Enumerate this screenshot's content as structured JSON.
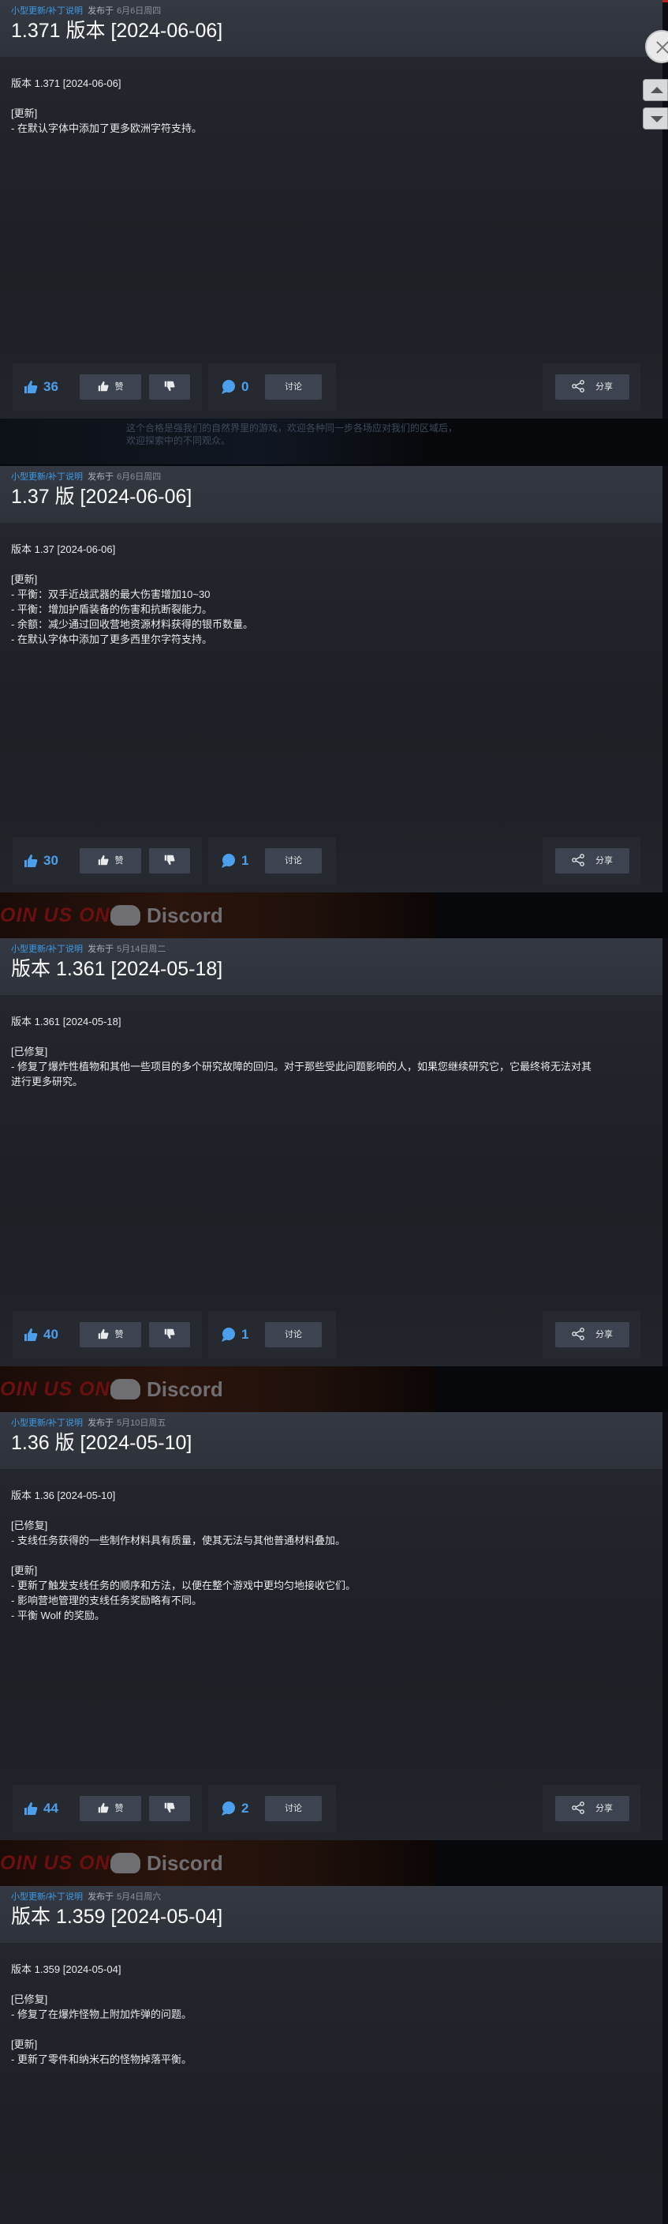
{
  "posts": [
    {
      "tag": "小型更新/补丁说明",
      "published_prefix": "发布于",
      "date": "6月6日周四",
      "title": "1.371 版本 [2024-06-06]",
      "lines": [
        "版本 1.371 [2024-06-06]",
        "",
        "[更新]",
        "- 在默认字体中添加了更多欧洲字符支持。"
      ],
      "likes": "36",
      "comments": "0"
    },
    {
      "tag": "小型更新/补丁说明",
      "published_prefix": "发布于",
      "date": "6月6日周四",
      "title": "1.37 版 [2024-06-06]",
      "lines": [
        "版本 1.37 [2024-06-06]",
        "",
        "[更新]",
        "- 平衡：双手近战武器的最大伤害增加10~30",
        "- 平衡：增加护盾装备的伤害和抗断裂能力。",
        "- 余额：减少通过回收营地资源材料获得的银币数量。",
        "- 在默认字体中添加了更多西里尔字符支持。"
      ],
      "likes": "30",
      "comments": "1"
    },
    {
      "tag": "小型更新/补丁说明",
      "published_prefix": "发布于",
      "date": "5月14日周二",
      "title": "版本 1.361 [2024-05-18]",
      "lines": [
        "版本 1.361 [2024-05-18]",
        "",
        "[已修复]",
        "- 修复了爆炸性植物和其他一些项目的多个研究故障的回归。对于那些受此问题影响的人，如果您继续研究它，它最终将无法对其",
        "进行更多研究。"
      ],
      "likes": "40",
      "comments": "1"
    },
    {
      "tag": "小型更新/补丁说明",
      "published_prefix": "发布于",
      "date": "5月10日周五",
      "title": "1.36 版 [2024-05-10]",
      "lines": [
        "版本 1.36 [2024-05-10]",
        "",
        "[已修复]",
        "- 支线任务获得的一些制作材料具有质量，使其无法与其他普通材料叠加。",
        "",
        "[更新]",
        "- 更新了触发支线任务的顺序和方法，以便在整个游戏中更均匀地接收它们。",
        "- 影响营地管理的支线任务奖励略有不同。",
        "- 平衡 Wolf 的奖励。"
      ],
      "likes": "44",
      "comments": "2"
    },
    {
      "tag": "小型更新/补丁说明",
      "published_prefix": "发布于",
      "date": "5月4日周六",
      "title": "版本 1.359 [2024-05-04]",
      "lines": [
        "版本 1.359 [2024-05-04]",
        "",
        "[已修复]",
        "- 修复了在爆炸怪物上附加炸弹的问题。",
        "",
        "[更新]",
        "- 更新了零件和纳米石的怪物掉落平衡。"
      ],
      "likes": null,
      "comments": null
    }
  ],
  "buttons": {
    "like": "赞",
    "discuss": "讨论",
    "share": "分享"
  },
  "banner": {
    "join_text": "OIN US ON",
    "discord_text": "Discord",
    "strip_text_1": "这个合格是强我们的自然界里的游戏，欢迎各种同一步各场应对我们的区域后，",
    "strip_text_2": "欢迎探索中的不同观众。"
  },
  "colors": {
    "accent_blue": "#3e9be6",
    "count_blue": "#4c9fea",
    "button_bg": "#3d4350",
    "card_bg": "#23262d"
  },
  "icons": [
    "thumbs-up-icon",
    "thumbs-down-icon",
    "chat-bubble-icon",
    "share-icon",
    "close-icon",
    "scroll-up-icon",
    "scroll-down-icon"
  ]
}
